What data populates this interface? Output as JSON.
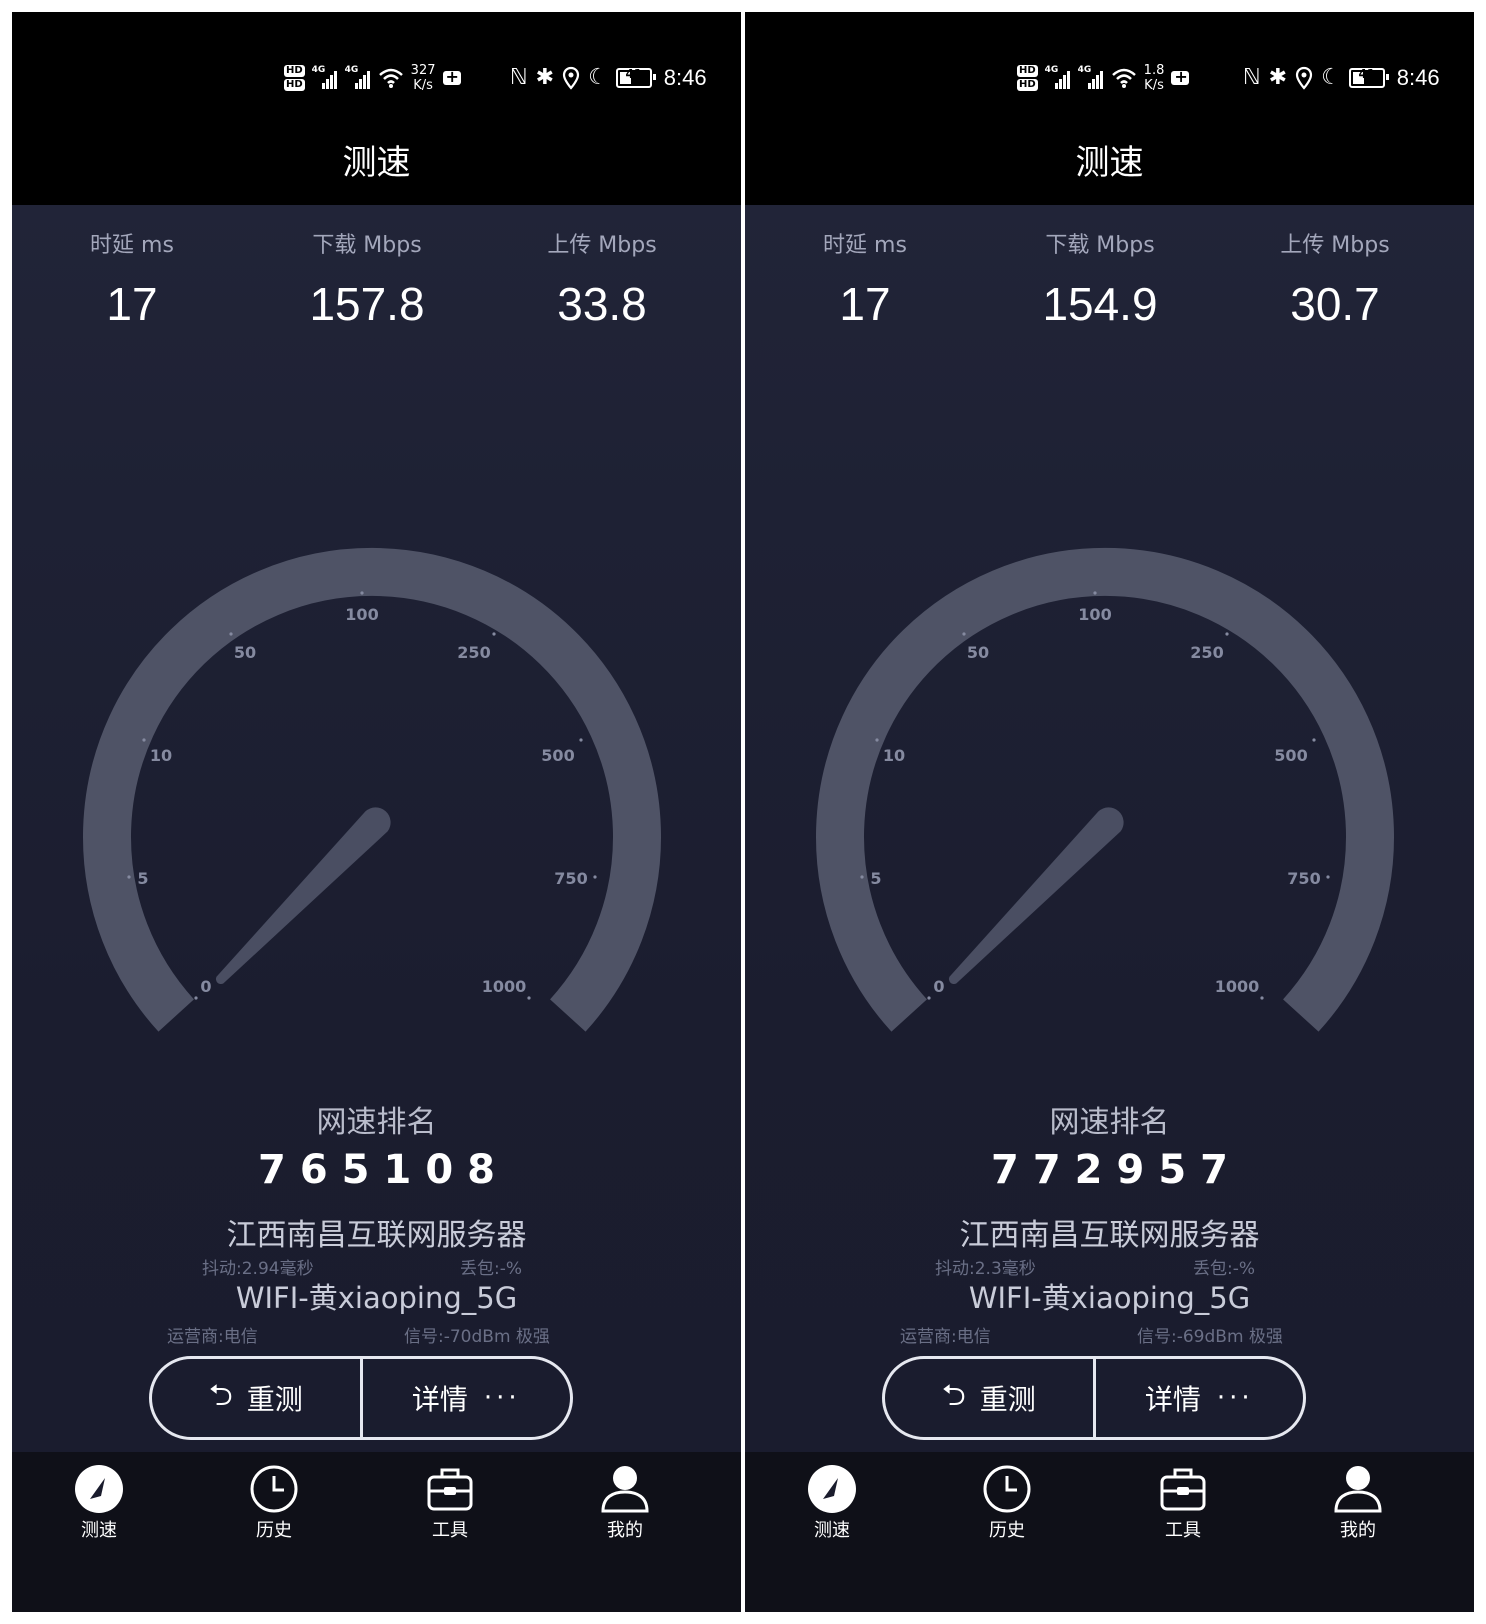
{
  "common": {
    "header_title": "测速",
    "clock": "8:46",
    "battery_level": "41",
    "hd1": "HD",
    "hd2": "HD",
    "net_unit": "K/s",
    "sim_gen": "4G",
    "stat_labels": {
      "latency": "时延 ms",
      "download": "下载 Mbps",
      "upload": "上传 Mbps"
    },
    "gauge_ticks": [
      "0",
      "5",
      "10",
      "50",
      "100",
      "250",
      "500",
      "750",
      "1000"
    ],
    "rank_title": "网速排名",
    "server": "江西南昌互联网服务器",
    "wifi_name": "WIFI-黄xiaoping_5G",
    "carrier": "运营商:电信",
    "retest_label": "重测",
    "details_label": "详情",
    "details_dots": "···",
    "tabs": {
      "test": "测速",
      "history": "历史",
      "tools": "工具",
      "mine": "我的"
    },
    "colors": {
      "background": "#1e2134",
      "gauge_arc": "#4f5366",
      "needle": "#4a4e62",
      "status_bar": "#000000"
    }
  },
  "left": {
    "net_speed": "327",
    "latency": "17",
    "download": "157.8",
    "upload": "33.8",
    "rank": "765108",
    "jitter": "抖动:2.94毫秒",
    "packet_loss": "丢包:-%",
    "signal": "信号:-70dBm 极强"
  },
  "right": {
    "net_speed": "1.8",
    "latency": "17",
    "download": "154.9",
    "upload": "30.7",
    "rank": "772957",
    "jitter": "抖动:2.3毫秒",
    "packet_loss": "丢包:-%",
    "signal": "信号:-69dBm 极强"
  }
}
